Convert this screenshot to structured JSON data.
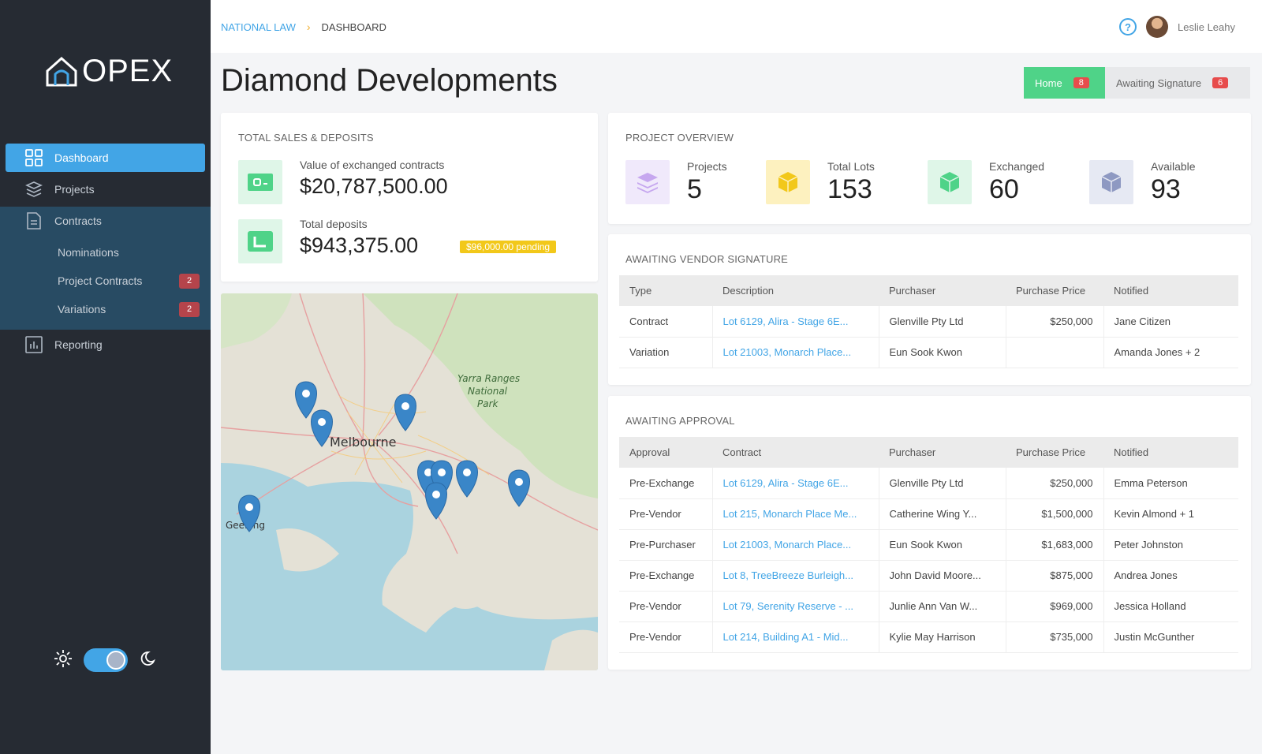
{
  "app": {
    "logo_text": "OPEX"
  },
  "sidebar": {
    "items": [
      {
        "label": "Dashboard",
        "icon": "grid-icon"
      },
      {
        "label": "Projects",
        "icon": "layers-icon"
      },
      {
        "label": "Contracts",
        "icon": "document-icon"
      },
      {
        "label": "Reporting",
        "icon": "chart-icon"
      }
    ],
    "sub_items": [
      {
        "label": "Nominations",
        "badge": ""
      },
      {
        "label": "Project Contracts",
        "badge": "2"
      },
      {
        "label": "Variations",
        "badge": "2"
      }
    ],
    "theme": {
      "light_icon": "sun-icon",
      "dark_icon": "moon-icon"
    }
  },
  "breadcrumb": {
    "root": "NATIONAL LAW",
    "current": "DASHBOARD"
  },
  "user": {
    "name": "Leslie Leahy"
  },
  "page": {
    "title": "Diamond Developments"
  },
  "tabs": [
    {
      "label": "Home",
      "count": "8"
    },
    {
      "label": "Awaiting Signature",
      "count": "6"
    }
  ],
  "sales": {
    "title": "TOTAL SALES  & DEPOSITS",
    "exchanged_label": "Value of exchanged contracts",
    "exchanged_value": "$20,787,500.00",
    "deposits_label": "Total deposits",
    "deposits_value": "$943,375.00",
    "pending": "$96,000.00 pending"
  },
  "overview": {
    "title": "PROJECT OVERVIEW",
    "stats": [
      {
        "label": "Projects",
        "value": "5",
        "color": "#f0e9fb"
      },
      {
        "label": "Total Lots",
        "value": "153",
        "color": "#fdf1bf"
      },
      {
        "label": "Exchanged",
        "value": "60",
        "color": "#dff6e8"
      },
      {
        "label": "Available",
        "value": "93",
        "color": "#e6e9f3"
      }
    ]
  },
  "vendor_sig": {
    "title": "AWAITING VENDOR SIGNATURE",
    "headers": [
      "Type",
      "Description",
      "Purchaser",
      "Purchase Price",
      "Notified"
    ],
    "rows": [
      [
        "Contract",
        "Lot 6129, Alira - Stage 6E...",
        "Glenville Pty Ltd",
        "$250,000",
        "Jane Citizen"
      ],
      [
        "Variation",
        "Lot 21003, Monarch Place...",
        "Eun Sook Kwon",
        "",
        "Amanda Jones + 2"
      ]
    ]
  },
  "approval": {
    "title": "AWAITING APPROVAL",
    "headers": [
      "Approval",
      "Contract",
      "Purchaser",
      "Purchase Price",
      "Notified"
    ],
    "rows": [
      [
        "Pre-Exchange",
        "Lot 6129, Alira - Stage 6E...",
        "Glenville Pty Ltd",
        "$250,000",
        "Emma Peterson"
      ],
      [
        "Pre-Vendor",
        "Lot 215, Monarch Place Me...",
        "Catherine Wing Y...",
        "$1,500,000",
        "Kevin Almond + 1"
      ],
      [
        "Pre-Purchaser",
        "Lot 21003, Monarch Place...",
        "Eun Sook Kwon",
        "$1,683,000",
        "Peter Johnston"
      ],
      [
        "Pre-Exchange",
        "Lot 8, TreeBreeze Burleigh...",
        "John David Moore...",
        "$875,000",
        "Andrea Jones"
      ],
      [
        "Pre-Vendor",
        "Lot 79, Serenity Reserve - ...",
        "Junlie Ann Van W...",
        "$969,000",
        "Jessica Holland"
      ],
      [
        "Pre-Vendor",
        "Lot 214, Building A1 - Mid...",
        "Kylie May Harrison",
        "$735,000",
        "Justin McGunther"
      ]
    ]
  },
  "map": {
    "labels": {
      "city": "Melbourne",
      "park": "Yarra Ranges National Park",
      "town": "Geelong"
    },
    "marker_color": "#3a86c8"
  }
}
